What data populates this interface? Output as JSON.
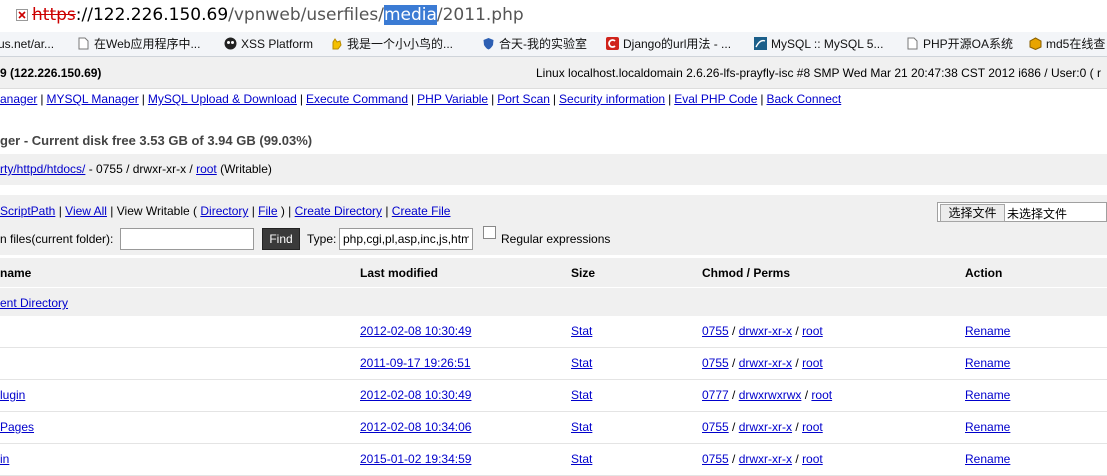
{
  "address": {
    "scheme": "https",
    "rest_host": "://122.226.150.69",
    "path1": "/vpnweb/userfiles/",
    "selected": "media",
    "path2": "/2011.php"
  },
  "bookmarks": [
    {
      "label": "us.net/ar...",
      "icon": "page-icon"
    },
    {
      "label": "在Web应用程序中...",
      "icon": "page-icon"
    },
    {
      "label": "XSS Platform",
      "icon": "skull-icon"
    },
    {
      "label": "我是一个小小鸟的...",
      "icon": "hand-icon"
    },
    {
      "label": "合天-我的实验室",
      "icon": "shield-icon"
    },
    {
      "label": "Django的url用法 - ...",
      "icon": "red-c-icon"
    },
    {
      "label": "MySQL :: MySQL 5...",
      "icon": "mysql-icon"
    },
    {
      "label": "PHP开源OA系统",
      "icon": "page-icon"
    },
    {
      "label": "md5在线查",
      "icon": "cube-icon"
    }
  ],
  "server": {
    "ip": "9 (122.226.150.69)",
    "info": "Linux localhost.localdomain 2.6.26-lfs-prayfly-isc #8 SMP Wed Mar 21 20:47:38 CST 2012 i686 / User:0 ( r"
  },
  "nav": [
    "anager",
    "MYSQL Manager",
    "MySQL Upload & Download",
    "Execute Command",
    "PHP Variable",
    "Port Scan",
    "Security information",
    "Eval PHP Code",
    "Back Connect"
  ],
  "heading": "ger - Current disk free 3.53 GB of 3.94 GB (99.03%)",
  "path": {
    "link": "rty/httpd/htdocs/",
    "perm": " - 0755 / drwxr-xr-x / ",
    "owner": "root",
    "writable": " (Writable)"
  },
  "tools": {
    "script_path": "ScriptPath",
    "view_all": "View All",
    "view_writable": "View Writable (",
    "directory": "Directory",
    "file": "File",
    "create_directory": "Create Directory",
    "create_file": "Create File",
    "search_label": "n files(current folder):",
    "search_value": "",
    "find_button": "Find",
    "type_label": "Type:",
    "type_value": "php,cgi,pl,asp,inc,js,htm",
    "regex_label": "Regular expressions",
    "choose_file_button": "选择文件",
    "no_file_chosen": "未选择文件"
  },
  "table": {
    "headers": {
      "name": "name",
      "modified": "Last modified",
      "size": "Size",
      "perms": "Chmod / Perms",
      "action": "Action"
    },
    "parent": "ent Directory",
    "rows": [
      {
        "name": "",
        "modified": "2012-02-08 10:30:49",
        "size": "Stat",
        "chmod": "0755",
        "perm": "drwxr-xr-x",
        "owner": "root",
        "action": "Rename"
      },
      {
        "name": "",
        "modified": "2011-09-17 19:26:51",
        "size": "Stat",
        "chmod": "0755",
        "perm": "drwxr-xr-x",
        "owner": "root",
        "action": "Rename"
      },
      {
        "name": "lugin",
        "modified": "2012-02-08 10:30:49",
        "size": "Stat",
        "chmod": "0777",
        "perm": "drwxrwxrwx",
        "owner": "root",
        "action": "Rename"
      },
      {
        "name": "Pages",
        "modified": "2012-02-08 10:34:06",
        "size": "Stat",
        "chmod": "0755",
        "perm": "drwxr-xr-x",
        "owner": "root",
        "action": "Rename"
      },
      {
        "name": "in",
        "modified": "2015-01-02 19:34:59",
        "size": "Stat",
        "chmod": "0755",
        "perm": "drwxr-xr-x",
        "owner": "root",
        "action": "Rename"
      }
    ]
  },
  "colors": {
    "link": "#0000cc",
    "selection": "#3b7bd4",
    "panel": "#f0f0f0",
    "find_button": "#3a3a3a"
  }
}
